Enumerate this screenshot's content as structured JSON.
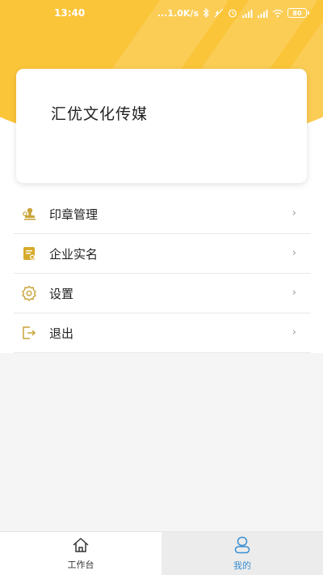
{
  "status_bar": {
    "time": "13:40",
    "speed": "...1.0K/s",
    "battery": "80"
  },
  "profile": {
    "company_name": "汇优文化传媒"
  },
  "menu": {
    "items": [
      {
        "label": "印章管理",
        "icon": "seal-icon"
      },
      {
        "label": "企业实名",
        "icon": "enterprise-doc-icon"
      },
      {
        "label": "设置",
        "icon": "gear-icon"
      },
      {
        "label": "退出",
        "icon": "logout-icon"
      }
    ],
    "chevron": "›"
  },
  "tabbar": {
    "tabs": [
      {
        "label": "工作台",
        "icon": "home-icon",
        "active": false
      },
      {
        "label": "我的",
        "icon": "user-icon",
        "active": true
      }
    ]
  },
  "colors": {
    "accent": "#fbc53a",
    "icon_gold": "#c9a43a",
    "active_tab": "#3a8fd1"
  }
}
